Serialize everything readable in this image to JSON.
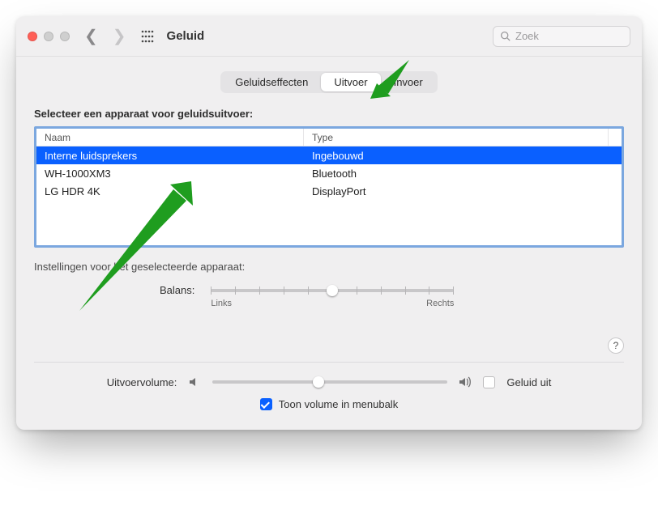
{
  "header": {
    "title": "Geluid",
    "search_placeholder": "Zoek"
  },
  "tabs": {
    "effects_label": "Geluidseffecten",
    "output_label": "Uitvoer",
    "input_label": "Invoer",
    "active": "Uitvoer"
  },
  "section": {
    "select_device_label": "Selecteer een apparaat voor geluidsuitvoer:",
    "col_name": "Naam",
    "col_type": "Type"
  },
  "devices": [
    {
      "name": "Interne luidsprekers",
      "type": "Ingebouwd",
      "selected": true
    },
    {
      "name": "WH-1000XM3",
      "type": "Bluetooth",
      "selected": false
    },
    {
      "name": "LG HDR 4K",
      "type": "DisplayPort",
      "selected": false
    }
  ],
  "settings": {
    "settings_for_selected_label": "Instellingen voor het geselecteerde apparaat:",
    "balance_label": "Balans:",
    "left_label": "Links",
    "right_label": "Rechts"
  },
  "volume": {
    "output_volume_label": "Uitvoervolume:",
    "mute_label": "Geluid uit",
    "show_in_menubar_label": "Toon volume in menubalk",
    "show_in_menubar_checked": true,
    "mute_checked": false
  },
  "help_char": "?"
}
